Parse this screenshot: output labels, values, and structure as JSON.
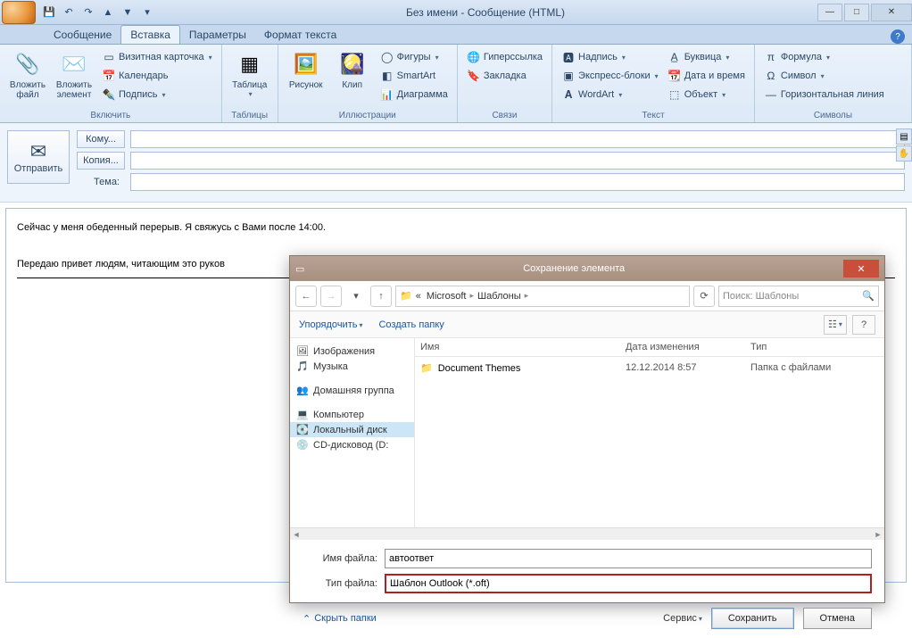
{
  "window": {
    "title": "Без имени - Сообщение (HTML)"
  },
  "tabs": {
    "msg": "Сообщение",
    "insert": "Вставка",
    "options": "Параметры",
    "format": "Формат текста"
  },
  "ribbon": {
    "include": {
      "attach_file": "Вложить файл",
      "attach_item": "Вложить элемент",
      "business_card": "Визитная карточка",
      "calendar": "Календарь",
      "signature": "Подпись",
      "group": "Включить"
    },
    "tables": {
      "table": "Таблица",
      "group": "Таблицы"
    },
    "illus": {
      "picture": "Рисунок",
      "clip": "Клип",
      "shapes": "Фигуры",
      "smartart": "SmartArt",
      "chart": "Диаграмма",
      "group": "Иллюстрации"
    },
    "links": {
      "hyperlink": "Гиперссылка",
      "bookmark": "Закладка",
      "group": "Связи"
    },
    "text": {
      "textbox": "Надпись",
      "quickparts": "Экспресс-блоки",
      "wordart": "WordArt",
      "dropcap": "Буквица",
      "datetime": "Дата и время",
      "object": "Объект",
      "group": "Текст"
    },
    "symbols": {
      "equation": "Формула",
      "symbol": "Символ",
      "hr": "Горизонтальная линия",
      "group": "Символы"
    }
  },
  "compose": {
    "send": "Отправить",
    "to": "Кому...",
    "cc": "Копия...",
    "subject": "Тема:",
    "to_val": "",
    "cc_val": "",
    "subject_val": ""
  },
  "body": {
    "line1": "Сейчас у меня обеденный перерыв. Я свяжусь с Вами после 14:00.",
    "line2": "Передаю привет людям, читающим это руков"
  },
  "dialog": {
    "title": "Сохранение элемента",
    "bc_prefix": "«",
    "bc1": "Microsoft",
    "bc2": "Шаблоны",
    "search_placeholder": "Поиск: Шаблоны",
    "organize": "Упорядочить",
    "new_folder": "Создать папку",
    "tree": {
      "images": "Изображения",
      "music": "Музыка",
      "homegroup": "Домашняя группа",
      "computer": "Компьютер",
      "localdisk": "Локальный диск",
      "cddrive": "CD-дисковод (D:"
    },
    "columns": {
      "name": "Имя",
      "date": "Дата изменения",
      "type": "Тип"
    },
    "item": {
      "name": "Document Themes",
      "date": "12.12.2014 8:57",
      "type": "Папка с файлами"
    },
    "filename_label": "Имя файла:",
    "filetype_label": "Тип файла:",
    "filename_value": "автоответ",
    "filetype_value": "Шаблон Outlook (*.oft)",
    "hide": "Скрыть папки",
    "tools": "Сервис",
    "save": "Сохранить",
    "cancel": "Отмена"
  }
}
